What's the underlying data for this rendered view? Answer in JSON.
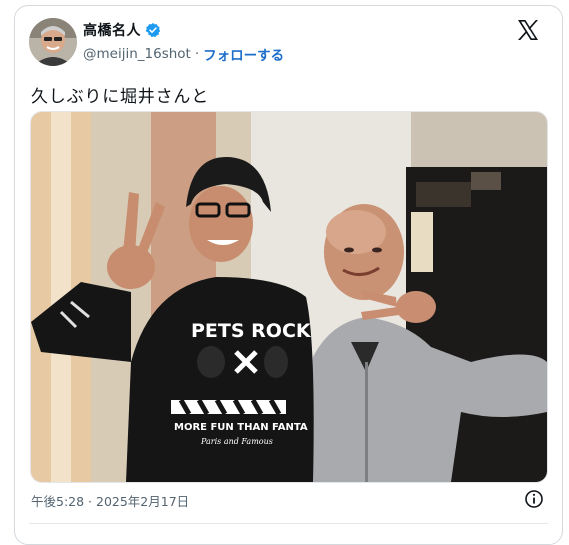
{
  "user": {
    "display_name": "高橋名人",
    "handle": "@meijin_16shot",
    "separator": "·",
    "follow_label": "フォローする",
    "verified": true,
    "avatar": "profile-photo"
  },
  "post": {
    "text": "久しぶりに堀井さんと",
    "timestamp": "午後5:28 · 2025年2月17日",
    "image_alt": "photo of two men making peace signs",
    "shirt_print": {
      "line1": "PETS ROCK",
      "line2": "MORE FUN THAN FANTA",
      "line3": "Paris and Famous"
    }
  },
  "icons": {
    "platform": "x-logo-icon",
    "verified": "verified-badge-icon",
    "info": "info-icon"
  },
  "colors": {
    "link": "#1d6ec9",
    "verified": "#1d9bf0",
    "text": "#0f1419",
    "muted": "#536471"
  }
}
